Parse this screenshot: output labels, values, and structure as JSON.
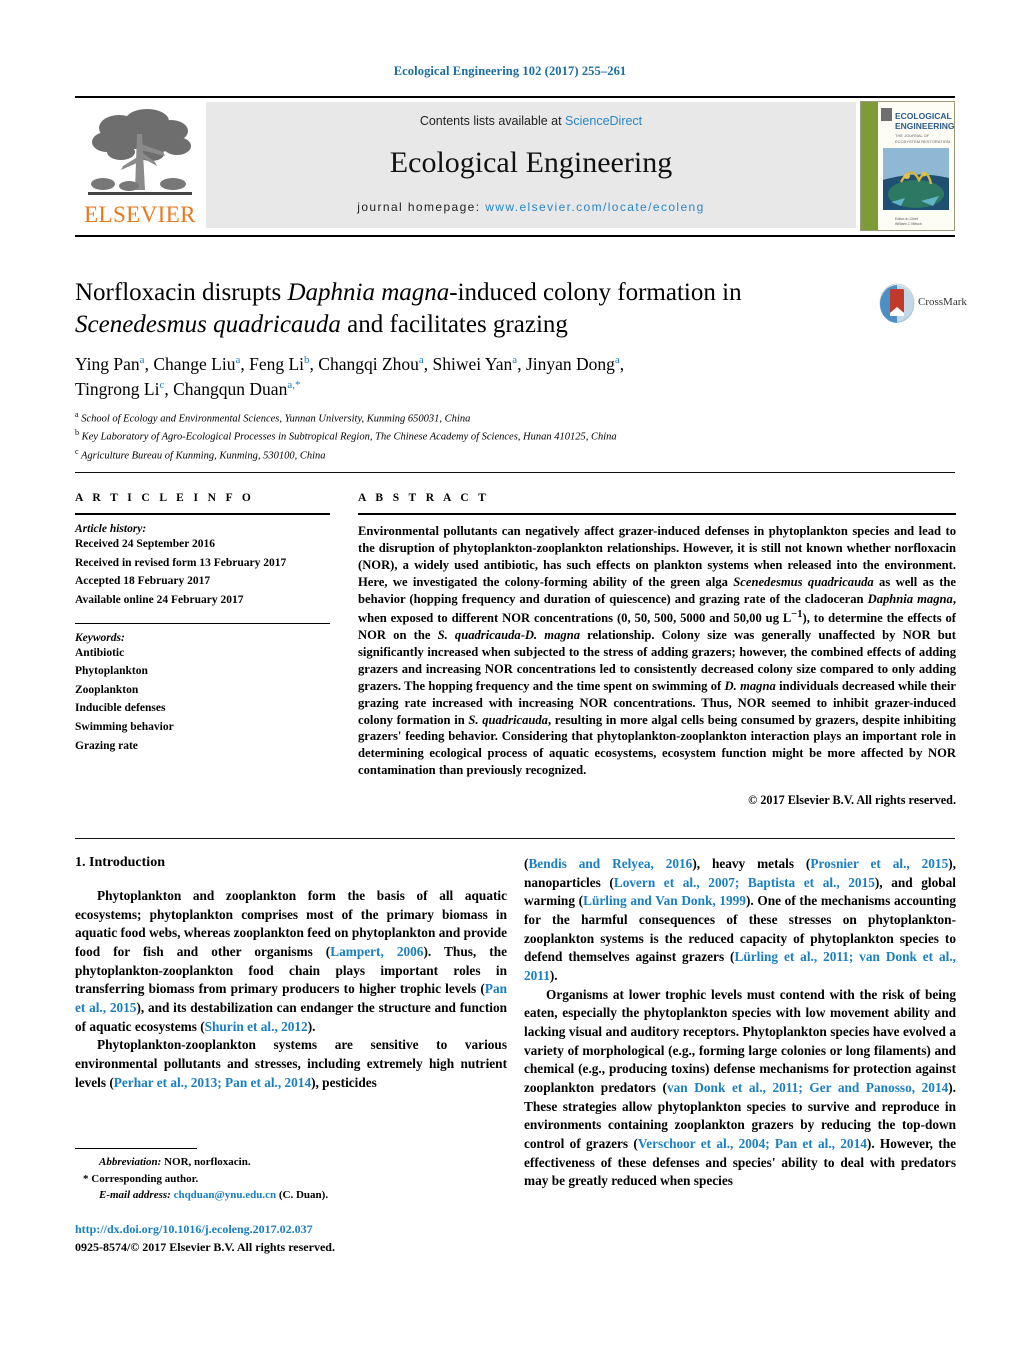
{
  "running_head": "Ecological Engineering 102 (2017) 255–261",
  "masthead": {
    "contents_prefix": "Contents lists available at ",
    "sciencedirect": "ScienceDirect",
    "journal_title": "Ecological Engineering",
    "homepage_prefix": "journal homepage: ",
    "homepage_url": "www.elsevier.com/locate/ecoleng",
    "publisher_logo_text": "ELSEVIER",
    "cover_title_line1": "ECOLOGICAL",
    "cover_title_line2": "ENGINEERING",
    "crossmark_label": "CrossMark"
  },
  "article": {
    "title_part1": "Norfloxacin disrupts ",
    "title_italic1": "Daphnia magna",
    "title_part2": "-induced colony formation in ",
    "title_italic2": "Scenedesmus quadricauda",
    "title_part3": " and facilitates grazing",
    "authors_line1": "Ying Pan<sup>a</sup>, Change Liu<sup>a</sup>, Feng Li<sup>b</sup>, Changqi Zhou<sup>a</sup>, Shiwei Yan<sup>a</sup>, Jinyan Dong<sup>a</sup>,",
    "authors_line2": "Tingrong Li<sup>c</sup>, Changqun Duan<sup>a,</sup><sup>*</sup>",
    "affiliations": [
      "<sup>a</sup> School of Ecology and Environmental Sciences, Yunnan University, Kunming 650031, China",
      "<sup>b</sup> Key Laboratory of Agro-Ecological Processes in Subtropical Region, The Chinese Academy of Sciences, Hunan 410125, China",
      "<sup>c</sup> Agriculture Bureau of Kunming, Kunming, 530100, China"
    ]
  },
  "article_info": {
    "heading": "A R T I C L E   I N F O",
    "history_label": "Article history:",
    "history": [
      "Received 24 September 2016",
      "Received in revised form 13 February 2017",
      "Accepted 18 February 2017",
      "Available online 24 February 2017"
    ],
    "keywords_label": "Keywords:",
    "keywords": [
      "Antibiotic",
      "Phytoplankton",
      "Zooplankton",
      "Inducible defenses",
      "Swimming behavior",
      "Grazing rate"
    ]
  },
  "abstract": {
    "heading": "A B S T R A C T",
    "body": "Environmental pollutants can negatively affect grazer-induced defenses in phytoplankton species and lead to the disruption of phytoplankton-zooplankton relationships. However, it is still not known whether norfloxacin (NOR), a widely used antibiotic, has such effects on plankton systems when released into the environment. Here, we investigated the colony-forming ability of the green alga <i>Scenedesmus quadricauda</i> as well as the behavior (hopping frequency and duration of quiescence) and grazing rate of the cladoceran <i>Daphnia magna</i>, when exposed to different NOR concentrations (0, 50, 500, 5000 and 50,00 ug L<sup>−1</sup>), to determine the effects of NOR on the <i>S. quadricauda</i>-<i>D. magna</i> relationship. Colony size was generally unaffected by NOR but significantly increased when subjected to the stress of adding grazers; however, the combined effects of adding grazers and increasing NOR concentrations led to consistently decreased colony size compared to only adding grazers. The hopping frequency and the time spent on swimming of <i>D. magna</i> individuals decreased while their grazing rate increased with increasing NOR concentrations. Thus, NOR seemed to inhibit grazer-induced colony formation in <i>S. quadricauda</i>, resulting in more algal cells being consumed by grazers, despite inhibiting grazers' feeding behavior. Considering that phytoplankton-zooplankton interaction plays an important role in determining ecological process of aquatic ecosystems, ecosystem function might be more affected by NOR contamination than previously recognized.",
    "copyright": "© 2017 Elsevier B.V. All rights reserved."
  },
  "introduction": {
    "heading": "1.  Introduction",
    "left_paragraphs": [
      "Phytoplankton and zooplankton form the basis of all aquatic ecosystems; phytoplankton comprises most of the primary biomass in aquatic food webs, whereas zooplankton feed on phytoplankton and provide food for fish and other organisms (<span class=\"ref\">Lampert, 2006</span>). Thus, the phytoplankton-zooplankton food chain plays important roles in transferring biomass from primary producers to higher trophic levels (<span class=\"ref\">Pan et al., 2015</span>), and its destabilization can endanger the structure and function of aquatic ecosystems (<span class=\"ref\">Shurin et al., 2012</span>).",
      "Phytoplankton-zooplankton systems are sensitive to various environmental pollutants and stresses, including extremely high nutrient levels (<span class=\"ref\">Perhar et al., 2013; Pan et al., 2014</span>), pesticides"
    ],
    "right_paragraphs": [
      "(<span class=\"ref\">Bendis and Relyea, 2016</span>), heavy metals (<span class=\"ref\">Prosnier et al., 2015</span>), nanoparticles (<span class=\"ref\">Lovern et al., 2007; Baptista et al., 2015</span>), and global warming (<span class=\"ref\">Lürling and Van Donk, 1999</span>). One of the mechanisms accounting for the harmful consequences of these stresses on phytoplankton-zooplankton systems is the reduced capacity of phytoplankton species to defend themselves against grazers (<span class=\"ref\">Lürling et al., 2011; van Donk et al., 2011</span>).",
      "Organisms at lower trophic levels must contend with the risk of being eaten, especially the phytoplankton species with low movement ability and lacking visual and auditory receptors. Phytoplankton species have evolved a variety of morphological (e.g., forming large colonies or long filaments) and chemical (e.g., producing toxins) defense mechanisms for protection against zooplankton predators (<span class=\"ref\">van Donk et al., 2011; Ger and Panosso, 2014</span>). These strategies allow phytoplankton species to survive and reproduce in environments containing zooplankton grazers by reducing the top-down control of grazers (<span class=\"ref\">Verschoor et al., 2004; Pan et al., 2014</span>). However, the effectiveness of these defenses and species' ability to deal with predators may be greatly reduced when species"
    ]
  },
  "footnotes": {
    "abbreviation": "<i>Abbreviation:</i>  NOR, norfloxacin.",
    "corresponding": "* Corresponding author.",
    "email_label": "<i>E-mail address:</i> ",
    "email": "chqduan@ynu.edu.cn",
    "email_suffix": " (C. Duan).",
    "doi": "http://dx.doi.org/10.1016/j.ecoleng.2017.02.037",
    "issn": "0925-8574/© 2017 Elsevier B.V. All rights reserved."
  },
  "colors": {
    "link": "#1a7fbf",
    "running_head": "#1a6d9e",
    "elsevier_orange": "#e87a1e",
    "band_grey": "#e8e8e8"
  }
}
